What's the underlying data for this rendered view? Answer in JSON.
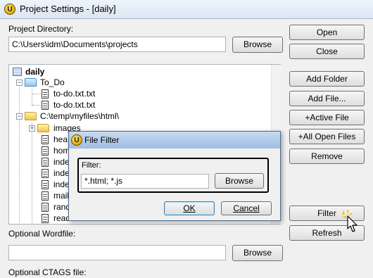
{
  "window": {
    "title": "Project Settings - [daily]"
  },
  "project_directory": {
    "label": "Project Directory:",
    "value": "C:\\Users\\idm\\Documents\\projects",
    "browse_label": "Browse"
  },
  "tree": {
    "root": "daily",
    "items": [
      "To_Do",
      "to-do.txt.txt",
      "to-do.txt.txt",
      "C:\\temp\\myfiles\\html\\",
      "images",
      "hea",
      "hom",
      "inde",
      "inde",
      "inde",
      "mail",
      "rand",
      "read"
    ]
  },
  "side_buttons": {
    "open": "Open",
    "close": "Close",
    "add_folder": "Add Folder",
    "add_file": "Add File...",
    "active_file": "+Active File",
    "all_open_files": "+All Open Files",
    "remove": "Remove",
    "filter": "Filter",
    "refresh": "Refresh"
  },
  "wordfile": {
    "label": "Optional Wordfile:",
    "value": "",
    "browse_label": "Browse"
  },
  "ctags": {
    "label": "Optional CTAGS file:"
  },
  "file_filter_dialog": {
    "title": "File Filter",
    "filter_label": "Filter:",
    "filter_value": "*.html; *.js",
    "browse_label": "Browse",
    "ok_label": "OK",
    "cancel_label": "Cancel"
  }
}
